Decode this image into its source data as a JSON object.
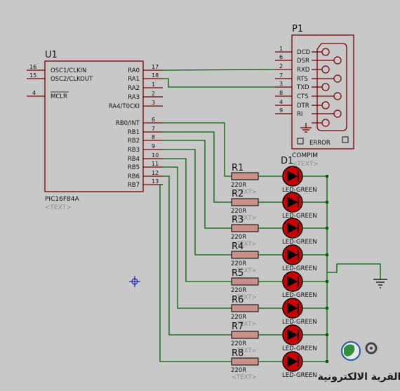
{
  "u1": {
    "ref": "U1",
    "part": "PIC16F84A",
    "text_placeholder": "<TEXT>",
    "left_pins": [
      {
        "num": "16",
        "name": "OSC1/CLKIN"
      },
      {
        "num": "15",
        "name": "OSC2/CLKOUT"
      },
      {
        "num": "4",
        "name": "MCLR"
      }
    ],
    "right_pins": [
      {
        "num": "17",
        "name": "RA0"
      },
      {
        "num": "18",
        "name": "RA1"
      },
      {
        "num": "1",
        "name": "RA2"
      },
      {
        "num": "2",
        "name": "RA3"
      },
      {
        "num": "3",
        "name": "RA4/T0CKI"
      },
      {
        "num": "6",
        "name": "RB0/INT"
      },
      {
        "num": "7",
        "name": "RB1"
      },
      {
        "num": "8",
        "name": "RB2"
      },
      {
        "num": "9",
        "name": "RB3"
      },
      {
        "num": "10",
        "name": "RB4"
      },
      {
        "num": "11",
        "name": "RB5"
      },
      {
        "num": "12",
        "name": "RB6"
      },
      {
        "num": "13",
        "name": "RB7"
      }
    ]
  },
  "p1": {
    "ref": "P1",
    "part": "COMPIM",
    "text_placeholder": "<TEXT>",
    "error_label": "ERROR",
    "pins": [
      {
        "num": "1",
        "name": "DCD"
      },
      {
        "num": "6",
        "name": "DSR"
      },
      {
        "num": "2",
        "name": "RXD"
      },
      {
        "num": "7",
        "name": "RTS"
      },
      {
        "num": "3",
        "name": "TXD"
      },
      {
        "num": "8",
        "name": "CTS"
      },
      {
        "num": "4",
        "name": "DTR"
      },
      {
        "num": "9",
        "name": "RI"
      }
    ]
  },
  "d1": {
    "ref": "D1"
  },
  "led_part": "LED-GREEN",
  "resistor_text_placeholder": "<TEXT>",
  "resistors": [
    {
      "ref": "R1",
      "value": "220R"
    },
    {
      "ref": "R2",
      "value": "220R"
    },
    {
      "ref": "R3",
      "value": "220R"
    },
    {
      "ref": "R4",
      "value": "220R"
    },
    {
      "ref": "R5",
      "value": "220R"
    },
    {
      "ref": "R6",
      "value": "220R"
    },
    {
      "ref": "R7",
      "value": "220R"
    },
    {
      "ref": "R8",
      "value": "220R"
    }
  ],
  "watermark": {
    "text": "القرية الالكترونية"
  },
  "colors": {
    "background": "#c8c8c8",
    "component_body": "#7a0000",
    "wire": "#006400",
    "led_fill": "#cc0000",
    "resistor_fill": "#c89088",
    "cursor": "#1a2aa8",
    "text_placeholder": "#8e8e8e"
  }
}
